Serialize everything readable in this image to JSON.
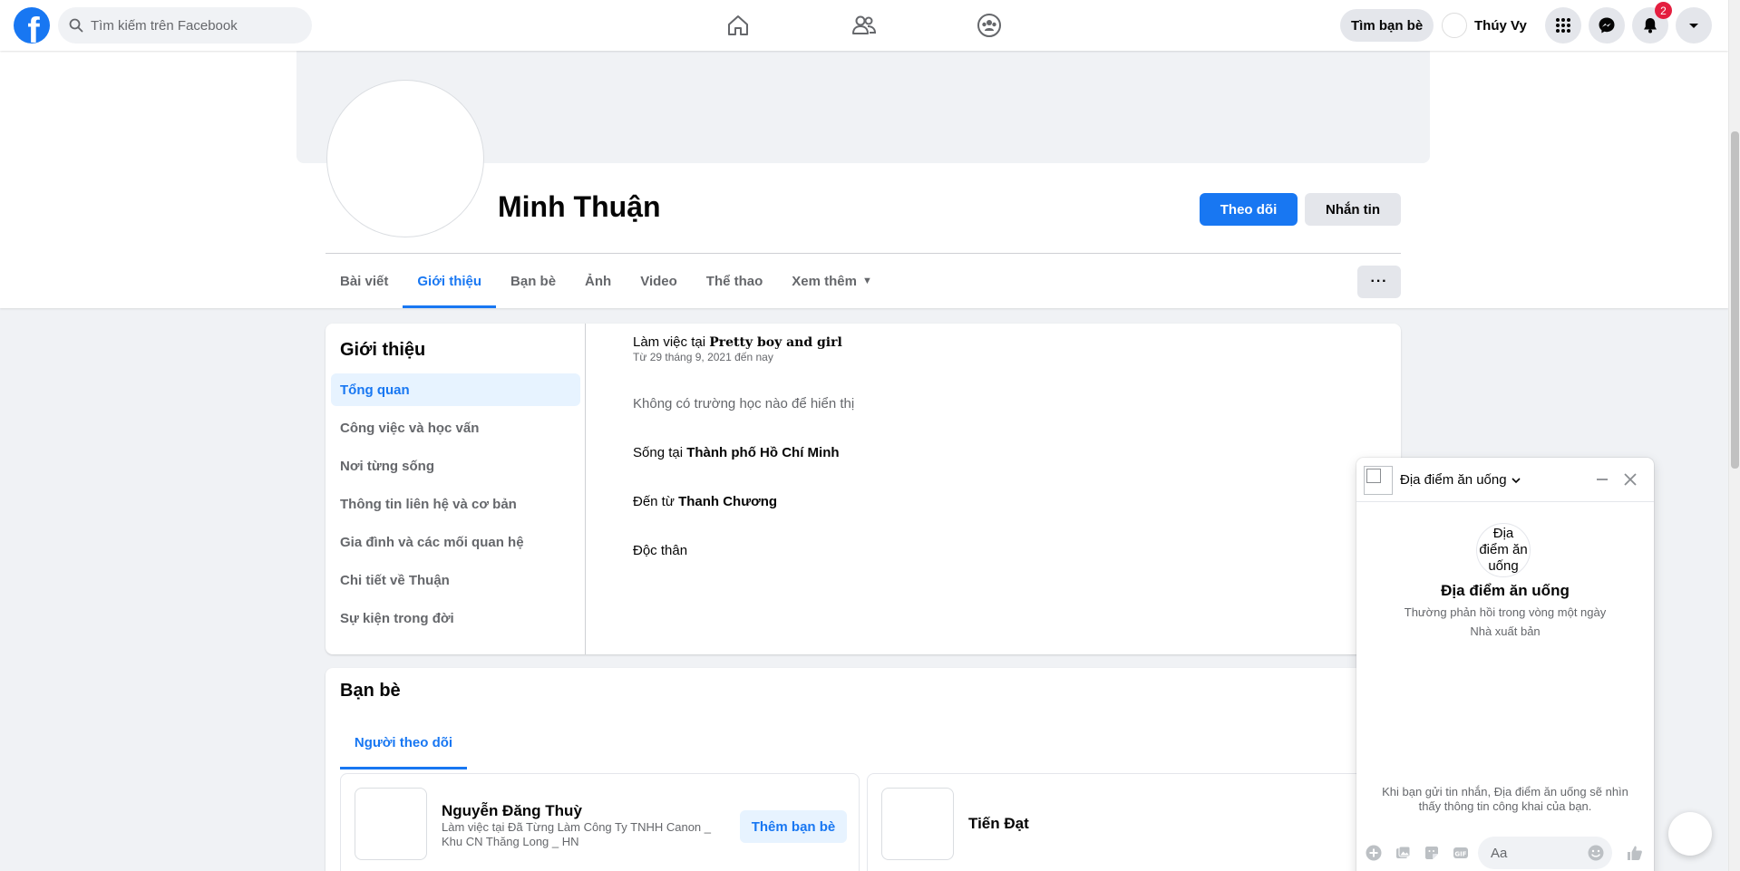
{
  "colors": {
    "accent": "#1877f2",
    "badge": "#e41e3f",
    "page_bg": "#f0f2f5"
  },
  "topbar": {
    "logo_icon": "facebook-logo",
    "search_placeholder": "Tìm kiếm trên Facebook",
    "nav_icons": [
      "home-icon",
      "friends-icon",
      "groups-icon"
    ],
    "find_friends_label": "Tìm bạn bè",
    "user_name": "Thúy Vy",
    "right_icons": [
      "menu-grid-icon",
      "messenger-icon",
      "bell-icon",
      "account-caret-icon"
    ],
    "notification_count": "2"
  },
  "profile": {
    "name": "Minh Thuận",
    "follow_label": "Theo dõi",
    "message_label": "Nhắn tin",
    "more_label": "···",
    "tabs": [
      "Bài viết",
      "Giới thiệu",
      "Bạn bè",
      "Ảnh",
      "Video",
      "Thể thao",
      "Xem thêm"
    ],
    "active_tab": "Giới thiệu"
  },
  "about": {
    "title": "Giới thiệu",
    "menu": [
      "Tổng quan",
      "Công việc và học vấn",
      "Nơi từng sống",
      "Thông tin liên hệ và cơ bản",
      "Gia đình và các mối quan hệ",
      "Chi tiết về Thuận",
      "Sự kiện trong đời"
    ],
    "work_prefix": "Làm việc tại ",
    "work_place": "Pretty boy and girl",
    "work_since": "Từ 29 tháng 9, 2021 đến nay",
    "no_school": "Không có trường học nào để hiển thị",
    "lives_prefix": "Sống tại ",
    "lives_place": "Thành phố Hồ Chí Minh",
    "from_prefix": "Đến từ ",
    "from_place": "Thanh Chương",
    "relationship": "Độc thân"
  },
  "friends": {
    "title": "Bạn bè",
    "tab": "Người theo dõi",
    "items": [
      {
        "name": "Nguyễn Đăng Thuỳ",
        "subtitle": "Làm việc tại Đã Từng Làm Công Ty TNHH Canon _ Khu CN Thăng Long _ HN",
        "action": "Thêm bạn bè"
      },
      {
        "name": "Tiến Đạt"
      }
    ]
  },
  "chat": {
    "name": "Địa điểm ăn uống",
    "avatar_alt": "Địa điểm ăn uống",
    "title": "Địa điểm ăn uống",
    "response_time": "Thường phản hồi trong vòng một ngày",
    "category": "Nhà xuất bản",
    "notice": "Khi bạn gửi tin nhắn, Địa điểm ăn uống sẽ nhìn thấy thông tin công khai của bạn.",
    "input_placeholder": "Aa",
    "tool_icons": [
      "plus-circle-icon",
      "image-icon",
      "sticker-icon",
      "gif-icon"
    ],
    "gif_label": "GIF"
  }
}
